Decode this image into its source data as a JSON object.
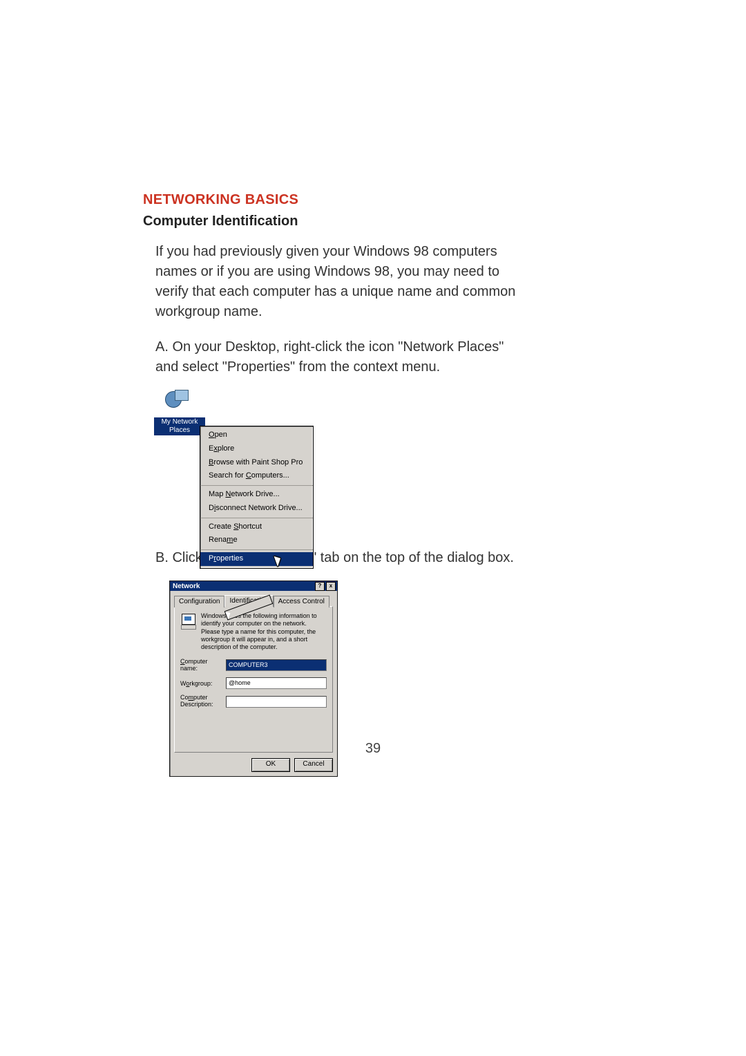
{
  "doc": {
    "section_title": "NETWORKING BASICS",
    "subtitle": "Computer Identification",
    "intro": "If you had previously given your Windows 98 computers names or if you are using Windows 98, you may need to verify that each computer has a unique name and common workgroup name.",
    "step_a": "A. On your Desktop, right-click the icon \"Network Places\" and select \"Properties\" from the context menu.",
    "step_b": "B. Click the \"Identification\" tab on the top of the dialog box.",
    "page_number": "39"
  },
  "fig1": {
    "icon_label": "My Network Places",
    "menu": {
      "group1": [
        "Open",
        "Explore",
        "Browse with Paint Shop Pro",
        "Search for Computers..."
      ],
      "group2": [
        "Map Network Drive...",
        "Disconnect Network Drive..."
      ],
      "group3": [
        "Create Shortcut",
        "Rename"
      ],
      "group4": [
        "Properties"
      ]
    }
  },
  "fig2": {
    "title": "Network",
    "help_btn": "?",
    "close_btn": "x",
    "tabs": {
      "configuration": "Configuration",
      "identification": "Identification",
      "access_control": "Access Control"
    },
    "info_text": "Windows uses the following information to identify your computer on the network. Please type a name for this computer, the workgroup it will appear in, and a short description of the computer.",
    "fields": {
      "computer_name_label": "Computer name:",
      "computer_name_value": "COMPUTER3",
      "workgroup_label": "Workgroup:",
      "workgroup_value": "@home",
      "description_label": "Computer Description:",
      "description_value": ""
    },
    "buttons": {
      "ok": "OK",
      "cancel": "Cancel"
    }
  }
}
